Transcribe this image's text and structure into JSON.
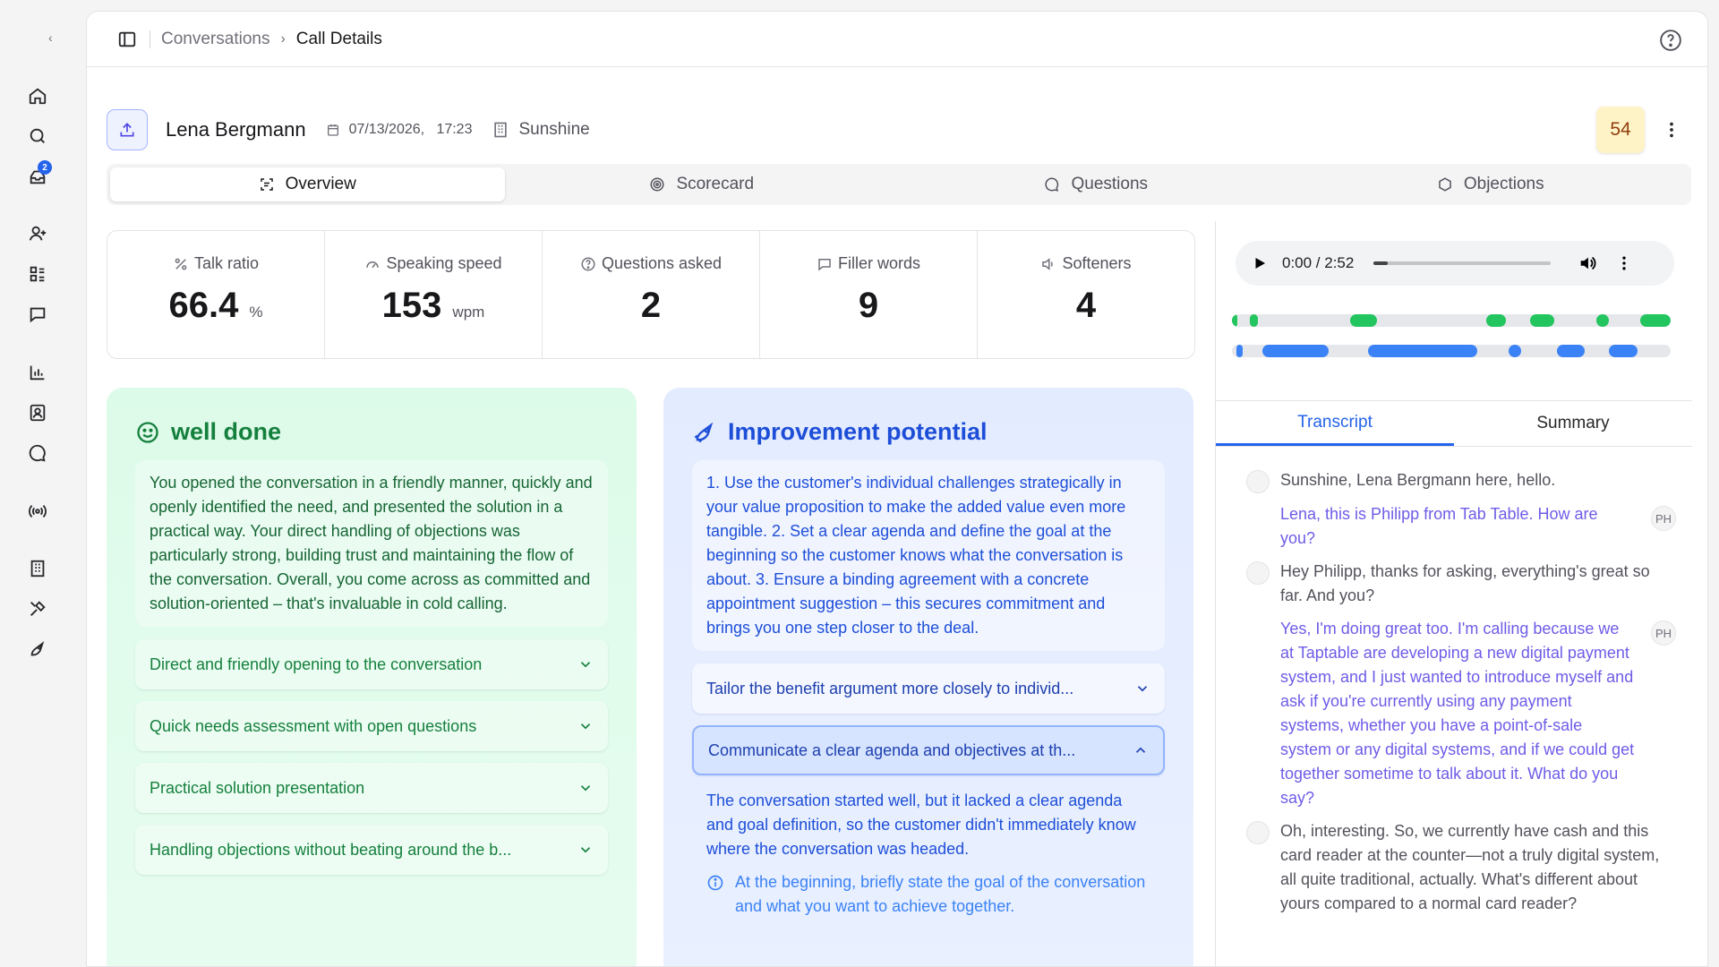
{
  "rail": {
    "notification_count": "2"
  },
  "breadcrumb": {
    "parent": "Conversations",
    "current": "Call Details"
  },
  "call": {
    "contact_name": "Lena Bergmann",
    "date": "07/13/2026,",
    "time": "17:23",
    "company": "Sunshine",
    "score": "54"
  },
  "tabs": [
    {
      "label": "Overview",
      "icon": "overview-icon",
      "active": true
    },
    {
      "label": "Scorecard",
      "icon": "target-icon"
    },
    {
      "label": "Questions",
      "icon": "chat-bubble-icon"
    },
    {
      "label": "Objections",
      "icon": "hexagon-icon"
    }
  ],
  "stats": [
    {
      "label": "Talk ratio",
      "icon": "percent-icon",
      "value": "66.4",
      "unit": "%"
    },
    {
      "label": "Speaking speed",
      "icon": "gauge-icon",
      "value": "153",
      "unit": "wpm"
    },
    {
      "label": "Questions asked",
      "icon": "question-circle-icon",
      "value": "2",
      "unit": ""
    },
    {
      "label": "Filler words",
      "icon": "message-square-icon",
      "value": "9",
      "unit": ""
    },
    {
      "label": "Softeners",
      "icon": "speaker-icon",
      "value": "4",
      "unit": ""
    }
  ],
  "well_done": {
    "title": "well done",
    "summary": "You opened the conversation in a friendly manner, quickly and openly identified the need, and presented the solution in a practical way. Your direct handling of objections was particularly strong, building trust and maintaining the flow of the conversation. Overall, you come across as committed and solution-oriented – that's invaluable in cold calling.",
    "items": [
      "Direct and friendly opening to the conversation",
      "Quick needs assessment with open questions",
      "Practical solution presentation",
      "Handling objections without beating around the b..."
    ]
  },
  "improvement": {
    "title": "Improvement potential",
    "summary": "1. Use the customer's individual challenges strategically in your value proposition to make the added value even more tangible. 2. Set a clear agenda and define the goal at the beginning so the customer knows what the conversation is about. 3. Ensure a binding agreement with a concrete appointment suggestion – this secures commitment and brings you one step closer to the deal.",
    "items": [
      {
        "label": "Tailor the benefit argument more closely to individ...",
        "open": false
      },
      {
        "label": "Communicate a clear agenda and objectives at th...",
        "open": true
      }
    ],
    "open_detail": "The conversation started well, but it lacked a clear agenda and goal definition, so the customer didn't immediately know where the conversation was headed.",
    "open_tip": "At the beginning, briefly state the goal of the conversation and what you want to achieve together."
  },
  "player": {
    "time": "0:00 / 2:52",
    "progress_fraction": 0.08
  },
  "speaker_tracks": {
    "customer": [
      [
        0,
        0.01
      ],
      [
        0.04,
        0.02
      ],
      [
        0.27,
        0.06
      ],
      [
        0.58,
        0.045
      ],
      [
        0.68,
        0.055
      ],
      [
        0.83,
        0.03
      ],
      [
        0.93,
        0.07
      ]
    ],
    "rep": [
      [
        0.01,
        0.015
      ],
      [
        0.07,
        0.15
      ],
      [
        0.31,
        0.25
      ],
      [
        0.63,
        0.03
      ],
      [
        0.74,
        0.065
      ],
      [
        0.86,
        0.065
      ]
    ]
  },
  "right_tabs": [
    {
      "label": "Transcript",
      "active": true
    },
    {
      "label": "Summary"
    }
  ],
  "transcript": [
    {
      "speaker": "customer",
      "text": "Sunshine, Lena Bergmann here, hello."
    },
    {
      "speaker": "rep",
      "initials": "PH",
      "text": "Lena, this is Philipp from Tab Table. How are you?"
    },
    {
      "speaker": "customer",
      "text": "Hey Philipp, thanks for asking, everything's great so far. And you?"
    },
    {
      "speaker": "rep",
      "initials": "PH",
      "text": "Yes, I'm doing great too. I'm calling because we at Taptable are developing a new digital payment system, and I just wanted to introduce myself and ask if you're currently using any payment systems, whether you have a point-of-sale system or any digital systems, and if we could get together sometime to talk about it. What do you say?"
    },
    {
      "speaker": "customer",
      "text": "Oh, interesting. So, we currently have cash and this card reader at the counter—not a truly digital system, all quite traditional, actually. What's different about yours compared to a normal card reader?"
    }
  ]
}
